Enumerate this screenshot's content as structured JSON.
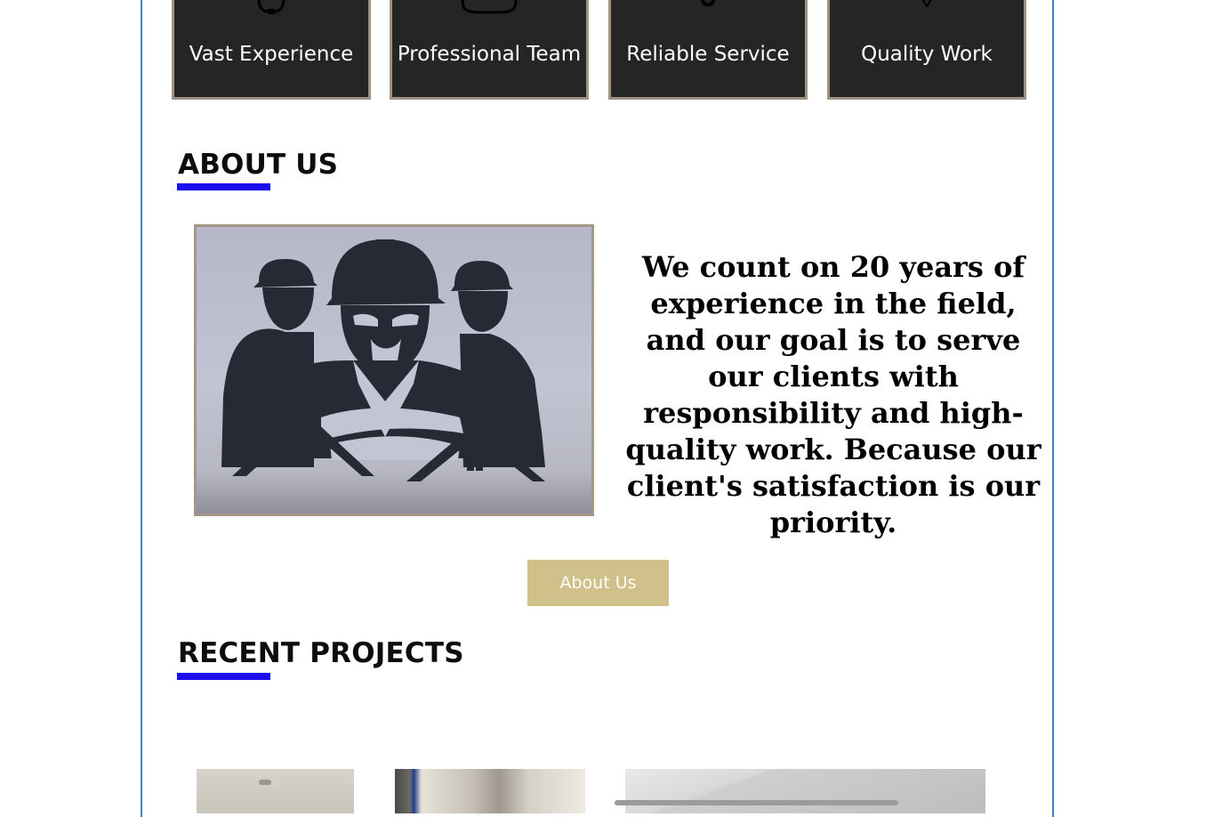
{
  "features": [
    {
      "label": "Vast Experience",
      "icon": "gear-icon"
    },
    {
      "label": "Professional Team",
      "icon": "hard-hat-icon"
    },
    {
      "label": "Reliable Service",
      "icon": "handshake-icon"
    },
    {
      "label": "Quality Work",
      "icon": "diamond-icon"
    }
  ],
  "about": {
    "heading": "ABOUT US",
    "text": "We count on 20 years of experience in the field, and our goal is to serve our clients with responsibility and high-quality work. Because our client's satisfaction is our priority.",
    "button_label": "About Us",
    "image": "construction-workers-logo"
  },
  "projects": {
    "heading": "RECENT PROJECTS"
  },
  "colors": {
    "accent_underline": "#1a0ef0",
    "card_background": "#252525",
    "card_border": "#a09282",
    "button_background": "#d0c08a",
    "frame_border": "#3b86c6"
  }
}
